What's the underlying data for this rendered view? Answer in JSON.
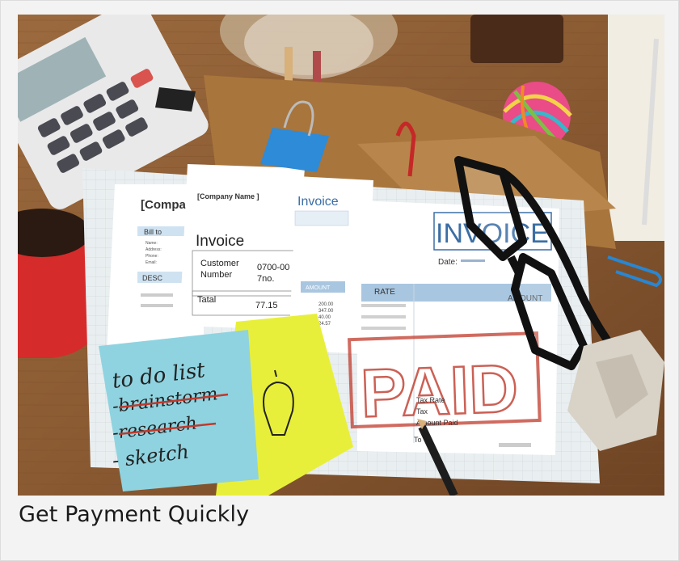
{
  "card": {
    "caption": "Get Payment Quickly"
  },
  "photo": {
    "colors": {
      "desk": "#8a5a32",
      "paid_stamp": "#c0392b",
      "sticky_blue": "#8fd3e0",
      "sticky_yellow": "#e8ef3a",
      "mug": "#d62b2b",
      "invoice_header_blue": "#3b6ea5"
    },
    "invoice_small": {
      "company": "[Company Name ]",
      "title": "Invoice",
      "customer_label": "Customer",
      "number_label": "Number",
      "customer_value": "0700-00",
      "number_value": "7no.",
      "total_label": "Tatal",
      "total_value": "77.15"
    },
    "invoice_left": {
      "company": "[Compa",
      "bill_to": "Bill to",
      "fields": [
        "Name:",
        "Address:",
        "Phone:",
        "Email:"
      ],
      "desc": "DESC"
    },
    "invoice_mid": {
      "title": "Invoice",
      "amount_header": "AMOUNT",
      "amounts": [
        "200.00",
        "347.00",
        "40.00",
        "24.57"
      ]
    },
    "invoice_main": {
      "title": "INVOICE",
      "date_label": "Date:",
      "rate_header": "RATE",
      "amount_header": "AMOUNT",
      "stamp": "PAID",
      "tax_rate": "Tax Rate",
      "tax": "Tax",
      "amount_paid": "Amount Paid",
      "total": "To"
    },
    "sticky_note": {
      "line1": "to do list",
      "line2": "-brainstorm",
      "line3": "-research",
      "line4": "- sketch"
    }
  }
}
